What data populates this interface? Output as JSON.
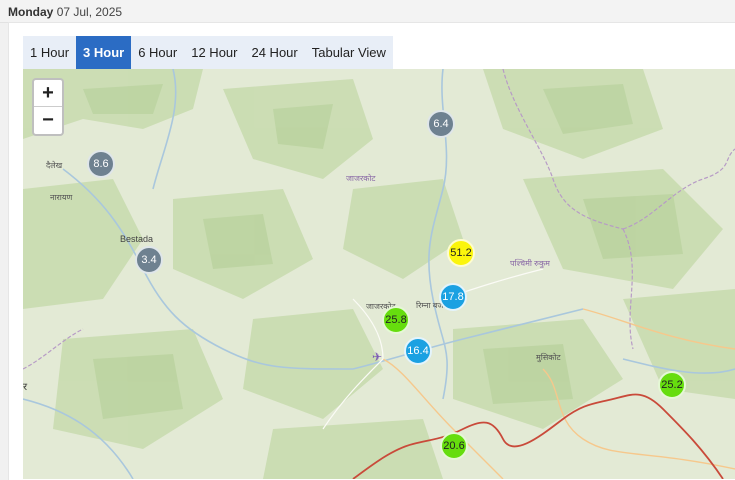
{
  "header": {
    "day": "Monday",
    "date": "07 Jul, 2025"
  },
  "tabs": [
    {
      "label": "1 Hour",
      "active": false
    },
    {
      "label": "3 Hour",
      "active": true
    },
    {
      "label": "6 Hour",
      "active": false
    },
    {
      "label": "12 Hour",
      "active": false
    },
    {
      "label": "24 Hour",
      "active": false
    },
    {
      "label": "Tabular View",
      "active": false
    }
  ],
  "map": {
    "zoom_in_label": "+",
    "zoom_out_label": "−",
    "places": [
      {
        "name": "दैलेख"
      },
      {
        "name": "नारायण"
      },
      {
        "name": "Bestada"
      },
      {
        "name": "जाजरकोट"
      },
      {
        "name": "पश्चिमी रुकुम"
      },
      {
        "name": "जाजरकोट"
      },
      {
        "name": "रिम्ना बजार"
      },
      {
        "name": "मुसिकोट"
      },
      {
        "name": "र"
      }
    ],
    "stations": [
      {
        "value": "6.4",
        "color": "gray"
      },
      {
        "value": "8.6",
        "color": "gray"
      },
      {
        "value": "3.4",
        "color": "gray"
      },
      {
        "value": "51.2",
        "color": "yellow"
      },
      {
        "value": "17.8",
        "color": "blue"
      },
      {
        "value": "25.8",
        "color": "green"
      },
      {
        "value": "16.4",
        "color": "blue"
      },
      {
        "value": "25.2",
        "color": "green"
      },
      {
        "value": "20.6",
        "color": "green"
      }
    ],
    "colors": {
      "gray": "#6e8190",
      "blue": "#1ba1e2",
      "yellow": "#fbf50c",
      "green": "#66dd0e"
    }
  }
}
